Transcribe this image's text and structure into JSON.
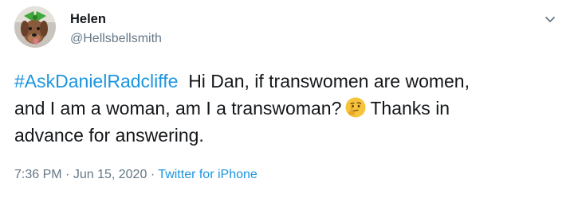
{
  "tweet": {
    "display_name": "Helen",
    "handle": "@Hellsbellsmith",
    "hashtag": "#AskDanielRadcliffe",
    "body_line1": "Hi Dan, if transwomen are women,",
    "body_line2": "and I am a woman, am I a transwoman?",
    "body_line3": "Thanks in",
    "body_line4": "advance for answering.",
    "emoji": "thinking-face",
    "time": "7:36 PM",
    "date": "Jun 15, 2020",
    "separator": "·",
    "source": "Twitter for iPhone"
  },
  "icons": {
    "menu": "chevron-down-icon",
    "avatar_image": "dog-with-green-bow"
  },
  "colors": {
    "link": "#1b95e0",
    "secondary_text": "#657786",
    "primary_text": "#14171a"
  }
}
